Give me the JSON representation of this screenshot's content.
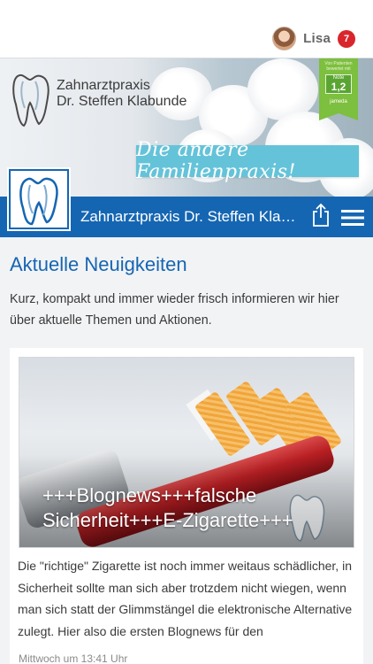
{
  "user": {
    "name": "Lisa",
    "notifications": "7"
  },
  "banner": {
    "brand_line1": "Zahnarztpraxis",
    "brand_line2": "Dr. Steffen Klabunde",
    "slogan": "Die andere Familienpraxis!",
    "jameda": {
      "label_top": "Von Patienten bewertet mit",
      "note_label": "Note",
      "note_value": "1,2",
      "brand": "jameda"
    }
  },
  "header": {
    "title": "Zahnarztpraxis Dr. Steffen Klabunde"
  },
  "main": {
    "heading": "Aktuelle Neuigkeiten",
    "intro": "Kurz, kompakt und immer wieder frisch informieren wir hier über aktuelle Themen und Aktionen."
  },
  "post": {
    "image_title": "+++Blognews+++falsche Sicherheit+++E-Zigarette+++",
    "excerpt": "Die \"richtige\" Zigarette ist noch immer weitaus schädlicher, in Sicherheit sollte man sich aber trotzdem nicht wiegen, wenn man sich statt der Glimmstängel die elektronische Alternative zulegt. Hier also die ersten Blognews für den",
    "timestamp": "Mittwoch um 13:41 Uhr"
  },
  "colors": {
    "brand_blue": "#1566b2",
    "slogan_teal": "#64c3d9",
    "jameda_green": "#7dbf3e",
    "badge_red": "#d9262c"
  },
  "icons": [
    "tooth-logo-icon",
    "share-icon",
    "hamburger-menu-icon"
  ]
}
